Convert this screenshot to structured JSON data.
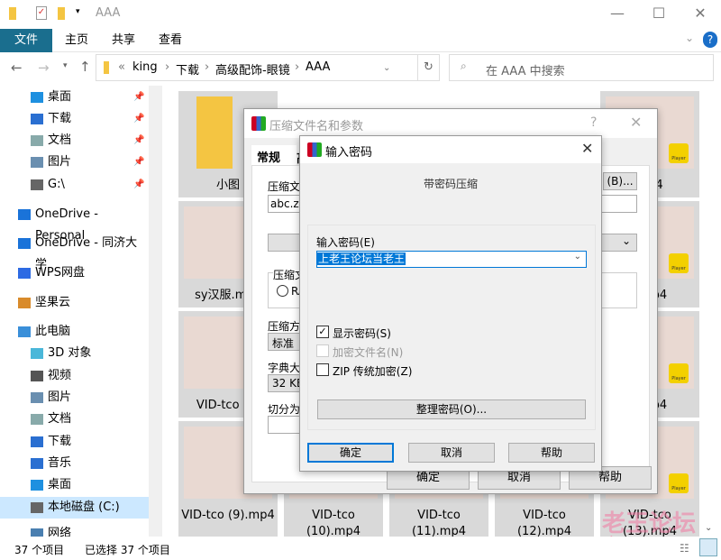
{
  "window": {
    "title": "AAA"
  },
  "ribbon": {
    "tabs": [
      "文件",
      "主页",
      "共享",
      "查看"
    ]
  },
  "address": {
    "prefix": "«",
    "crumbs": [
      "king",
      "下载",
      "高级配饰-眼镜",
      "AAA"
    ],
    "separator": "›",
    "refresh": "↻"
  },
  "search": {
    "placeholder": "在 AAA 中搜索"
  },
  "nav": {
    "items": [
      {
        "label": "桌面",
        "icon": "desktop-icon",
        "pinned": true
      },
      {
        "label": "下载",
        "icon": "download-icon",
        "pinned": true
      },
      {
        "label": "文档",
        "icon": "document-icon",
        "pinned": true
      },
      {
        "label": "图片",
        "icon": "picture-icon",
        "pinned": true
      },
      {
        "label": "G:\\",
        "icon": "drive-icon",
        "pinned": true
      },
      {
        "label": "OneDrive - Personal",
        "icon": "cloud-icon"
      },
      {
        "label": "OneDrive - 同济大学",
        "icon": "cloud-icon"
      },
      {
        "label": "WPS网盘",
        "icon": "wps-icon"
      },
      {
        "label": "坚果云",
        "icon": "nutstore-icon"
      },
      {
        "label": "此电脑",
        "icon": "computer-icon"
      },
      {
        "label": "3D 对象",
        "icon": "3d-icon"
      },
      {
        "label": "视频",
        "icon": "video-icon"
      },
      {
        "label": "图片",
        "icon": "picture-icon"
      },
      {
        "label": "文档",
        "icon": "document-icon"
      },
      {
        "label": "下载",
        "icon": "download-icon"
      },
      {
        "label": "音乐",
        "icon": "music-icon"
      },
      {
        "label": "桌面",
        "icon": "desktop-icon"
      },
      {
        "label": "本地磁盘 (C:)",
        "icon": "drive-icon",
        "selected": true
      },
      {
        "label": "网络",
        "icon": "network-icon"
      }
    ]
  },
  "files": [
    {
      "label": "小图",
      "type": "folder"
    },
    {
      "label": "sy汉服.mp4",
      "type": "video"
    },
    {
      "label": "VID-tco (4)",
      "type": "video"
    },
    {
      "label": "VID-tco (9).mp4",
      "type": "video"
    },
    {
      "label": "VID-tco (10).mp4",
      "type": "video"
    },
    {
      "label": "VID-tco (11).mp4",
      "type": "video"
    },
    {
      "label": "VID-tco (12).mp4",
      "type": "video"
    },
    {
      "label": "VID-tco (13).mp4",
      "type": "video"
    },
    {
      "label": "mp4",
      "type": "video"
    },
    {
      "label": ").mp4",
      "type": "video"
    },
    {
      "label": ").mp4",
      "type": "video"
    }
  ],
  "player_badge": "Player",
  "status": {
    "count": "37 个项目",
    "selected": "已选择 37 个项目"
  },
  "archive_dialog": {
    "title": "压缩文件名和参数",
    "help": "?",
    "tabs": [
      "常规",
      "高"
    ],
    "name_label": "压缩文",
    "name_value": "abc.zip",
    "browse": "(B)...",
    "format_label": "压缩文",
    "format_option": "RA",
    "method_label": "压缩方",
    "method_value": "标准",
    "dict_label": "字典大",
    "dict_value": "32 KB",
    "split_label": "切分为",
    "ok": "确定",
    "cancel": "取消",
    "help_btn": "帮助"
  },
  "password_dialog": {
    "title": "输入密码",
    "heading": "带密码压缩",
    "password_label": "输入密码(E)",
    "password_value": "上老王论坛当老王",
    "show_password": {
      "label": "显示密码(S)",
      "checked": true
    },
    "encrypt_names": {
      "label": "加密文件名(N)",
      "checked": false,
      "disabled": true
    },
    "zip_legacy": {
      "label": "ZIP 传统加密(Z)",
      "checked": false
    },
    "organize": "整理密码(O)...",
    "ok": "确定",
    "cancel": "取消",
    "help": "帮助"
  },
  "watermark": {
    "text": "老王论坛",
    "sub": "laowang"
  },
  "colors": {
    "accent": "#1a6e8e",
    "selection": "#0078d7",
    "player": "#f3d000"
  }
}
